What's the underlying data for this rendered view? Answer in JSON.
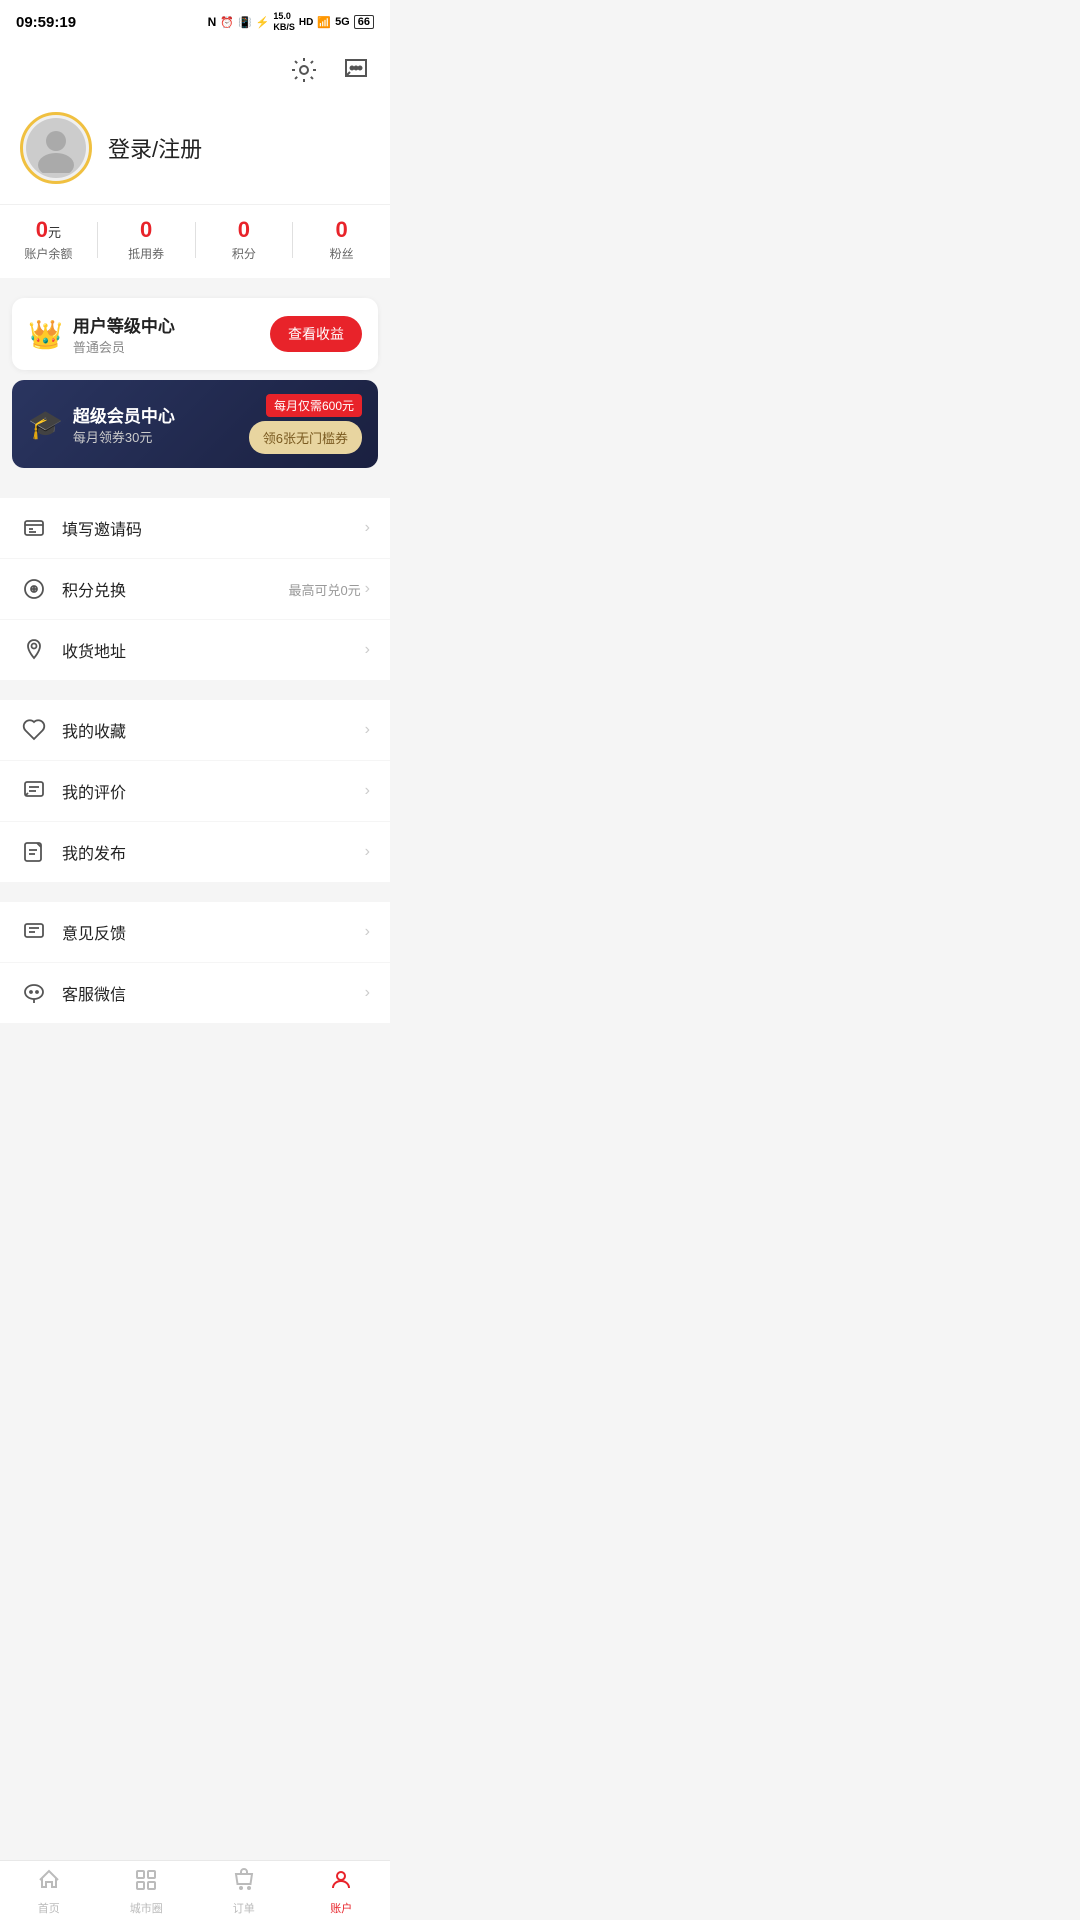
{
  "statusBar": {
    "time": "09:59:19",
    "icons": "NFC alarm vibrate bluetooth 15.0KB/s HD wifi 5G signal battery"
  },
  "topBar": {
    "settingsLabel": "settings",
    "chatLabel": "chat"
  },
  "profile": {
    "loginText": "登录/注册",
    "avatarAlt": "user avatar"
  },
  "stats": [
    {
      "value": "0",
      "unit": "元",
      "label": "账户余额"
    },
    {
      "value": "0",
      "unit": "",
      "label": "抵用券"
    },
    {
      "value": "0",
      "unit": "",
      "label": "积分"
    },
    {
      "value": "0",
      "unit": "",
      "label": "粉丝"
    }
  ],
  "memberCard": {
    "title": "用户等级中心",
    "subtitle": "普通会员",
    "buttonText": "查看收益",
    "crownIcon": "👑"
  },
  "superMember": {
    "title": "超级会员中心",
    "subtitle": "每月领券30元",
    "priceBadge": "每月仅需600元",
    "couponButton": "领6张无门槛券",
    "gradIcon": "🎓"
  },
  "menuItems": [
    {
      "icon": "invite",
      "label": "填写邀请码",
      "extra": "",
      "id": "invite-code"
    },
    {
      "icon": "points",
      "label": "积分兑换",
      "extra": "最高可兑0元",
      "id": "points-exchange"
    },
    {
      "icon": "address",
      "label": "收货地址",
      "extra": "",
      "id": "shipping-address"
    },
    {
      "icon": "favorite",
      "label": "我的收藏",
      "extra": "",
      "id": "my-favorites"
    },
    {
      "icon": "review",
      "label": "我的评价",
      "extra": "",
      "id": "my-reviews"
    },
    {
      "icon": "publish",
      "label": "我的发布",
      "extra": "",
      "id": "my-posts"
    },
    {
      "icon": "feedback",
      "label": "意见反馈",
      "extra": "",
      "id": "feedback"
    },
    {
      "icon": "wechat",
      "label": "客服微信",
      "extra": "",
      "id": "wechat-service"
    }
  ],
  "bottomNav": [
    {
      "label": "首页",
      "icon": "home",
      "active": false
    },
    {
      "label": "城市圈",
      "icon": "cityring",
      "active": false
    },
    {
      "label": "订单",
      "icon": "order",
      "active": false
    },
    {
      "label": "账户",
      "icon": "account",
      "active": true
    }
  ]
}
